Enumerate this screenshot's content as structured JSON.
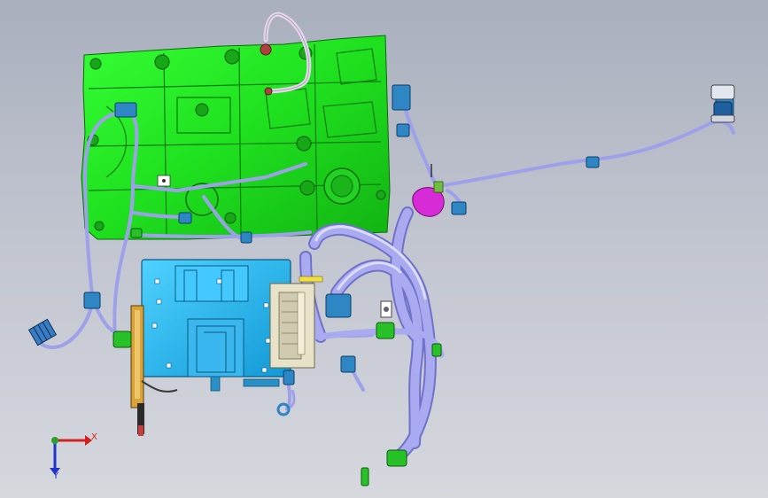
{
  "viewport": {
    "background": "#bfc3ce",
    "accent_block": "#21e021",
    "accent_module": "#21b8f0",
    "accent_harness": "#9ea1ea",
    "accent_connector": "#2e86c4",
    "accent_clip": "#28c228",
    "accent_magenta": "#d62bd6"
  },
  "triad": {
    "x_label": "X",
    "y_label": "Y",
    "x_color": "#d42020",
    "y_color": "#2233cc",
    "origin_color": "#2ca02c"
  }
}
